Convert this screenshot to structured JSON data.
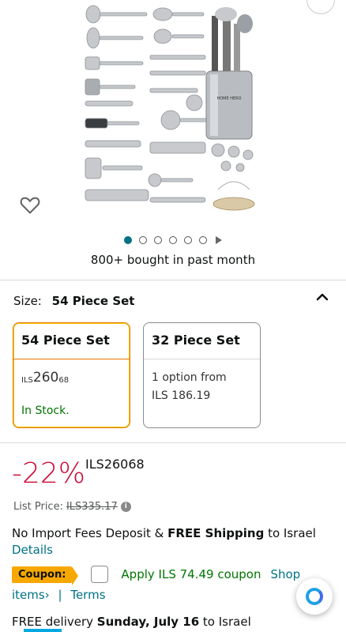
{
  "product": {
    "image_alt": "Kitchen utensil set with stainless steel holder",
    "holder_brand": "HOME HERO",
    "bought_text": "800+ bought in past month"
  },
  "carousel": {
    "count": 6,
    "active_index": 0
  },
  "size": {
    "label": "Size:",
    "selected": "54 Piece Set",
    "options": [
      {
        "title": "54 Piece Set",
        "currency": "ILS",
        "whole": "260",
        "fraction": "68",
        "stock": "In Stock."
      },
      {
        "title": "32 Piece Set",
        "line1": "1 option from",
        "line2": "ILS 186.19"
      }
    ]
  },
  "price": {
    "discount": "-22%",
    "currency": "ILS",
    "whole": "260",
    "fraction": "68",
    "list_label": "List Price:",
    "list_value": "ILS335.17",
    "info_glyph": "i"
  },
  "shipping": {
    "prefix": "No Import Fees Deposit & ",
    "bold": "FREE Shipping",
    "suffix": " to Israel",
    "details": "Details"
  },
  "coupon": {
    "badge": "Coupon:",
    "text": "Apply ILS 74.49 coupon",
    "shop": "Shop",
    "items": "items",
    "items_chevron": "›",
    "separator": "|",
    "terms": "Terms"
  },
  "delivery": {
    "prefix": "FREE delivery ",
    "date": "Sunday, July 16",
    "suffix": " to Israel"
  },
  "colors": {
    "link": "#007185",
    "deal_red": "#CC0C39",
    "in_stock_green": "#007600",
    "coupon_orange": "#F7A800",
    "selected_border": "#E77600"
  }
}
